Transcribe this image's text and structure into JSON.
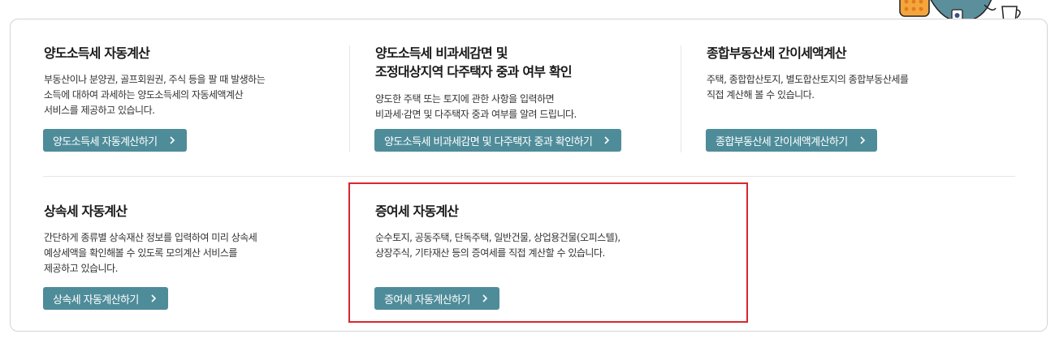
{
  "cards": [
    {
      "title_lines": [
        "양도소득세 자동계산"
      ],
      "desc_lines": [
        "부동산이나 분양권, 골프회원권, 주식 등을 팔 때 발생하는",
        "소득에 대하여 과세하는 양도소득세의 자동세액계산",
        "서비스를 제공하고 있습니다."
      ],
      "button_label": "양도소득세 자동계산하기"
    },
    {
      "title_lines": [
        "양도소득세 비과세감면 및",
        "조정대상지역 다주택자 중과 여부 확인"
      ],
      "desc_lines": [
        "양도한 주택 또는 토지에 관한 사항을 입력하면",
        "비과세·감면 및 다주택자 중과 여부를 알려 드립니다."
      ],
      "button_label": "양도소득세 비과세감면 및 다주택자 중과 확인하기"
    },
    {
      "title_lines": [
        "종합부동산세 간이세액계산"
      ],
      "desc_lines": [
        "주택, 종합합산토지, 별도합산토지의 종합부동산세를",
        "직접 계산해 볼 수 있습니다."
      ],
      "button_label": "종합부동산세 간이세액계산하기"
    },
    {
      "title_lines": [
        "상속세 자동계산"
      ],
      "desc_lines": [
        "간단하게 종류별 상속재산 정보를 입력하여 미리 상속세",
        "예상세액을 확인해볼 수 있도록 모의계산 서비스를",
        "제공하고 있습니다."
      ],
      "button_label": "상속세 자동계산하기"
    },
    {
      "title_lines": [
        "증여세 자동계산"
      ],
      "desc_lines": [
        "순수토지, 공동주택, 단독주택, 일반건물, 상업용건물(오피스텔),",
        "상장주식, 기타재산 등의 증여세를 직접 계산할 수 있습니다."
      ],
      "button_label": "증여세 자동계산하기"
    }
  ],
  "icons": {
    "button_arrow": "chevron-right-icon",
    "mascot": "mascot-illustration"
  },
  "colors": {
    "button_bg": "#4f8c9a",
    "highlight_border": "#d9262e",
    "mascot_body": "#5c8f9c"
  }
}
